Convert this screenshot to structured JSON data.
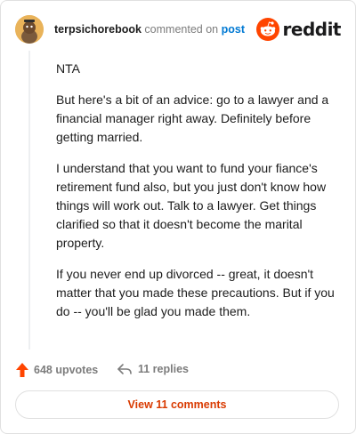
{
  "comment": {
    "username": "terpsichorebook",
    "action": "commented on",
    "post_link": "post",
    "paragraphs": [
      "NTA",
      "But here's a bit of an advice: go to a lawyer and a financial manager right away. Definitely before getting married.",
      "I understand that you want to fund your fiance's retirement fund also, but you just don't know how things will work out. Talk to a lawyer. Get things clarified so that it doesn't become the marital property.",
      "If you never end up divorced -- great, it doesn't matter that you made these precautions. But if you do -- you'll be glad you made them."
    ]
  },
  "brand": {
    "name": "reddit",
    "color": "#ff4500"
  },
  "footer": {
    "upvotes": "648 upvotes",
    "replies": "11 replies",
    "upvote_icon": "upvote-arrow-icon",
    "reply_icon": "reply-arrow-icon"
  },
  "view_button": {
    "label": "View 11 comments",
    "color": "#d93a00"
  }
}
